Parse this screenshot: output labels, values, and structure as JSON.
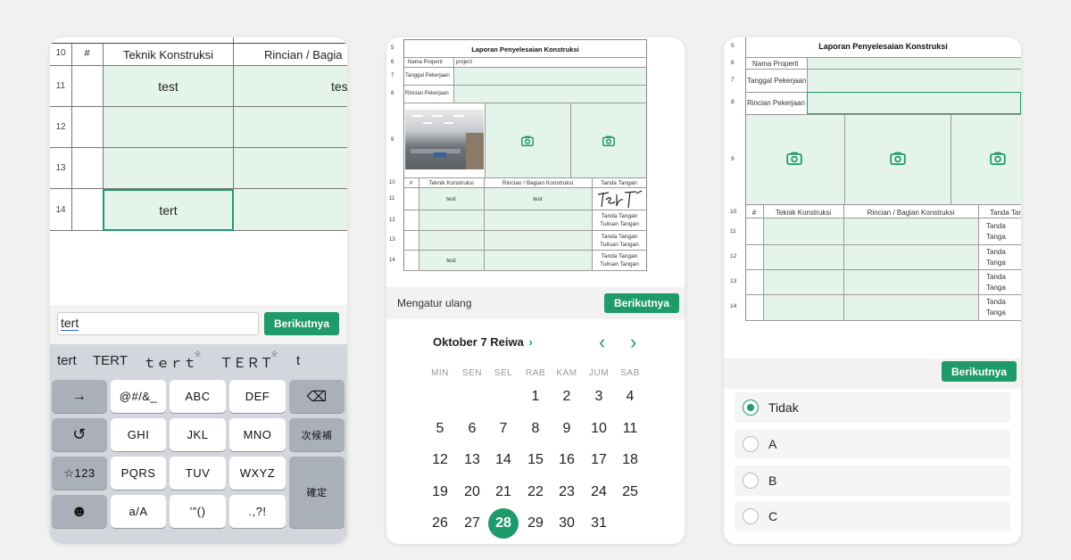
{
  "colors": {
    "accent": "#1f9a6a",
    "cell": "#e4f4ea",
    "keyboard": "#d3d6dc"
  },
  "left_screen": {
    "headers": {
      "row_no": "10",
      "hash": "#",
      "col1": "Teknik Konstruksi",
      "col2": "Rincian / Bagia"
    },
    "rows": [
      {
        "no": "11",
        "col1": "test",
        "col2": "tes"
      },
      {
        "no": "12",
        "col1": "",
        "col2": ""
      },
      {
        "no": "13",
        "col1": "",
        "col2": ""
      },
      {
        "no": "14",
        "col1": "tert",
        "col2": ""
      }
    ],
    "input_value": "tert",
    "next_button": "Berikutnya",
    "candidates": [
      "tert",
      "TERT",
      "ｔｅｒｔ",
      "ＴＥＲＴ",
      "t"
    ],
    "candidate_marks": [
      "全",
      "全"
    ],
    "keys": {
      "arrow": "→",
      "sym": "@#/&_",
      "abc": "ABC",
      "def": "DEF",
      "backspace": "⌫",
      "undo": "↺",
      "ghi": "GHI",
      "jkl": "JKL",
      "mno": "MNO",
      "kouho": "次候補",
      "num": "☆123",
      "pqrs": "PQRS",
      "tuv": "TUV",
      "wxyz": "WXYZ",
      "kakutei": "確定",
      "emoji": "☻",
      "case": "a/A",
      "quote": "’”()",
      "punct": ".,?!"
    }
  },
  "middle_screen": {
    "report_title": "Laporan Penyelesaian Konstruksi",
    "row_numbers": [
      "5",
      "6",
      "7",
      "8",
      "9",
      "10",
      "11",
      "12",
      "13",
      "14"
    ],
    "labels": {
      "property_name": "Nama Properti",
      "property_value": "project",
      "work_date": "Tanggal Pekerjaan",
      "work_detail": "Rincian Pekerjaan"
    },
    "table_headers": {
      "hash": "#",
      "col1": "Teknik Konstruksi",
      "col2": "Rincian / Bagian Konstruksi",
      "col3": "Tanda Tangan"
    },
    "rows": [
      {
        "col1": "test",
        "col2": "test",
        "col3": ""
      },
      {
        "col1": "",
        "col2": "",
        "col3": "Tanda Tangan Tulisan Tangan"
      },
      {
        "col1": "",
        "col2": "",
        "col3": "Tanda Tangan Tulisan Tangan"
      },
      {
        "col1": "test",
        "col2": "",
        "col3": "Tanda Tangan Tulisan Tangan"
      }
    ],
    "reset_label": "Mengatur ulang",
    "next_button": "Berikutnya",
    "calendar": {
      "month_label": "Oktober 7 Reiwa",
      "weekdays": [
        "MIN",
        "SEN",
        "SEL",
        "RAB",
        "KAM",
        "JUM",
        "SAB"
      ],
      "days": [
        "1",
        "2",
        "3",
        "4",
        "5",
        "6",
        "7",
        "8",
        "9",
        "10",
        "11",
        "12",
        "13",
        "14",
        "15",
        "16",
        "17",
        "18",
        "19",
        "20",
        "21",
        "22",
        "23",
        "24",
        "25",
        "26",
        "27",
        "28",
        "29",
        "30",
        "31"
      ],
      "selected_day": "28"
    }
  },
  "right_screen": {
    "report_title": "Laporan Penyelesaian Konstruksi",
    "row_numbers": [
      "5",
      "6",
      "7",
      "8",
      "9",
      "10",
      "11",
      "12",
      "13",
      "14"
    ],
    "labels": {
      "property_name": "Nama Properti",
      "work_date": "Tanggal Pekerjaan",
      "work_detail": "Rincian Pekerjaan"
    },
    "table_headers": {
      "hash": "#",
      "col1": "Teknik Konstruksi",
      "col2": "Rincian / Bagian Konstruksi",
      "col3": "Tanda Tan"
    },
    "sign_text": "Tanda Tanga Tulisan Tan",
    "next_button": "Berikutnya",
    "options": [
      "Tidak",
      "A",
      "B",
      "C"
    ],
    "selected_option": "Tidak"
  }
}
